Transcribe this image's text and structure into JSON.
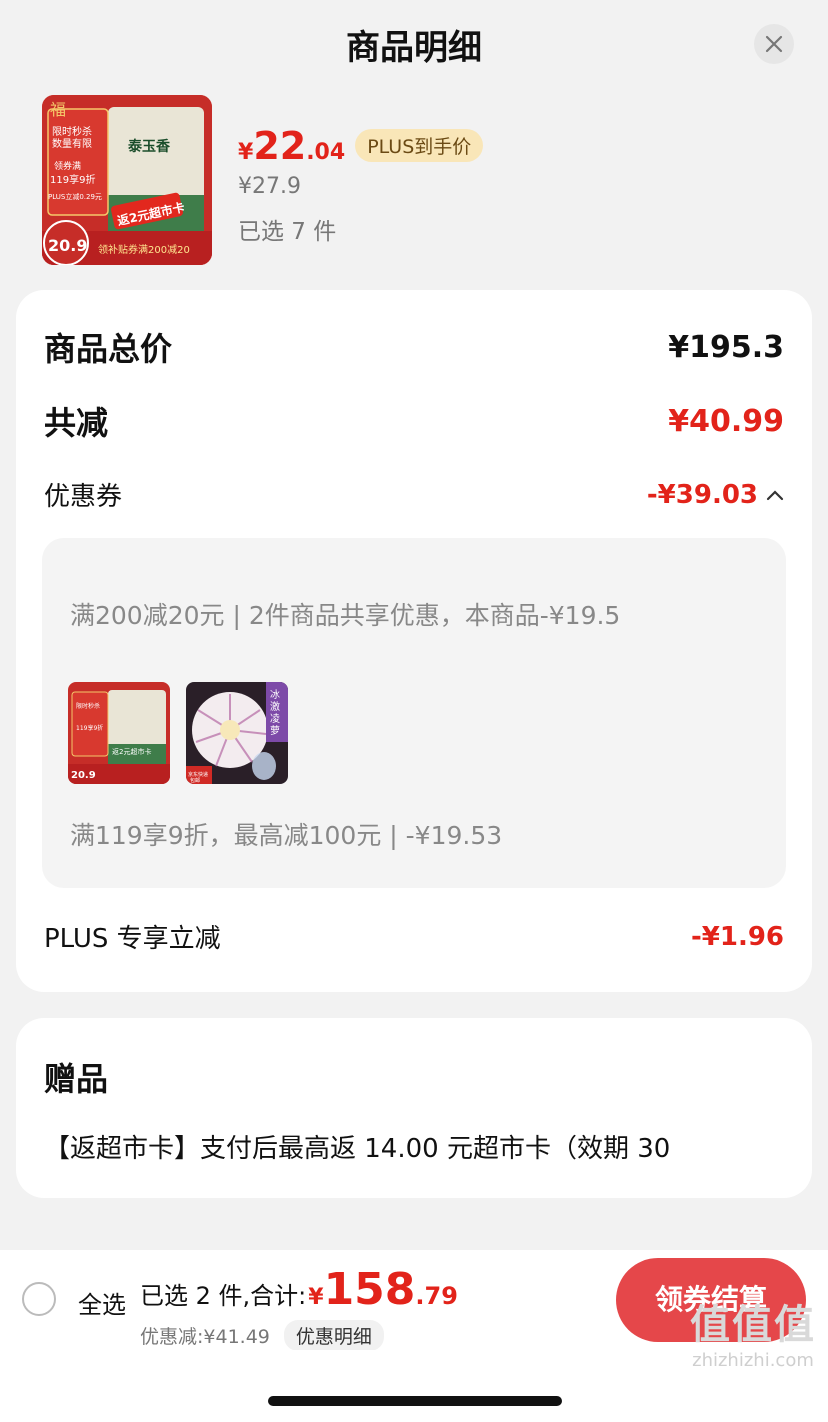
{
  "header": {
    "title": "商品明细"
  },
  "product": {
    "thumb_texts": {
      "flash": "限时秒杀 数量有限",
      "promo": "领券满 119享9折",
      "plus": "PLUS立减0.29元",
      "rebate": "返2元超市卡",
      "price_badge": "20.9",
      "bottom": "领补贴券满200减20",
      "brand": "泰玉香"
    },
    "price_yen": "¥",
    "price_int": "22",
    "price_dec": ".04",
    "plus_tag": "PLUS到手价",
    "orig_price": "¥27.9",
    "selected": "已选 7 件"
  },
  "summary": {
    "total_label": "商品总价",
    "total_value": "¥195.3",
    "reduce_label": "共减",
    "reduce_value": "¥40.99",
    "coupon_label": "优惠券",
    "coupon_value": "-¥39.03",
    "coupon_box": {
      "line1": "满200减20元 | 2件商品共享优惠，本商品-¥19.5",
      "thumb2_label": "冰激凌萝卜",
      "thumb2_corner": "京东快递 包邮",
      "line2": "满119享9折，最高减100元 | -¥19.53"
    },
    "plus_label": "PLUS 专享立减",
    "plus_value": "-¥1.96"
  },
  "gift": {
    "title": "赠品",
    "text": "【返超市卡】支付后最高返 14.00 元超市卡（效期 30"
  },
  "bottom": {
    "select_all": "全选",
    "total_label": "已选 2 件,合计:",
    "total_yen": "¥",
    "total_int": "158",
    "total_dec": ".79",
    "discount": "优惠减:¥41.49",
    "detail_chip": "优惠明细",
    "checkout": "领券结算"
  },
  "watermark": {
    "logo": "值值值",
    "url": "zhizhizhi.com"
  },
  "colors": {
    "accent": "#e2231a",
    "button": "#e5474a",
    "plus_tag_bg": "#f9e6b8"
  }
}
